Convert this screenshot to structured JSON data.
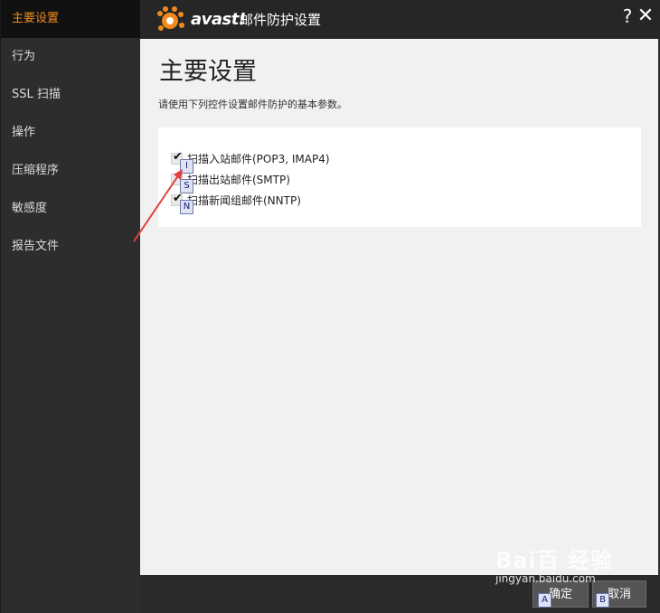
{
  "sidebar": {
    "items": [
      {
        "label": "主要设置",
        "active": true
      },
      {
        "label": "行为"
      },
      {
        "label": "SSL 扫描"
      },
      {
        "label": "操作"
      },
      {
        "label": "压缩程序"
      },
      {
        "label": "敏感度"
      },
      {
        "label": "报告文件"
      }
    ]
  },
  "titlebar": {
    "logo_text": "avast!",
    "title": "邮件防护设置",
    "help": "?",
    "close": "✕"
  },
  "main": {
    "page_title": "主要设置",
    "description": "请使用下列控件设置邮件防护的基本参数。",
    "options": [
      {
        "label": "扫描入站邮件(POP3, IMAP4)",
        "checked": true,
        "key": "I"
      },
      {
        "label": "扫描出站邮件(SMTP)",
        "checked": false,
        "key": "S"
      },
      {
        "label": "扫描新闻组邮件(NNTP)",
        "checked": true,
        "key": "N"
      }
    ]
  },
  "footer": {
    "ok_label": "确定",
    "ok_key": "A",
    "cancel_label": "取消",
    "cancel_key": "B"
  },
  "watermark": {
    "brand": "Bai百 经验",
    "url": "jingyan.baidu.com"
  },
  "colors": {
    "accent": "#f08a1c",
    "annotation_arrow": "#e04040"
  }
}
